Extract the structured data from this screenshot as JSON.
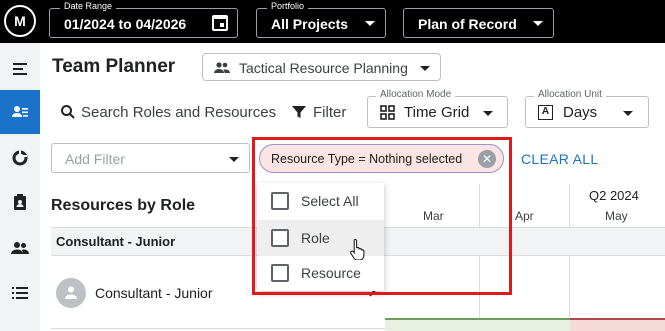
{
  "topbar": {
    "logo_text": "M",
    "date_range": {
      "label": "Date Range",
      "value": "01/2024 to 04/2026"
    },
    "portfolio": {
      "label": "Portfolio",
      "value": "All Projects"
    },
    "plan": {
      "value": "Plan of Record"
    }
  },
  "sidebar": {
    "items": [
      {
        "icon": "menu-icon"
      },
      {
        "icon": "team-planner-icon",
        "active": true
      },
      {
        "icon": "pie-chart-icon"
      },
      {
        "icon": "clipboard-person-icon"
      },
      {
        "icon": "people-icon"
      },
      {
        "icon": "list-icon"
      }
    ]
  },
  "header": {
    "title": "Team Planner",
    "view_select": "Tactical Resource Planning"
  },
  "toolbar": {
    "search_label": "Search Roles and Resources",
    "filter_label": "Filter",
    "allocation_mode": {
      "label": "Allocation Mode",
      "value": "Time Grid"
    },
    "allocation_unit": {
      "label": "Allocation Unit",
      "value": "Days"
    }
  },
  "filters": {
    "add_filter_placeholder": "Add Filter",
    "chip_text": "Resource Type = Nothing selected",
    "clear_all": "CLEAR ALL"
  },
  "dropdown": {
    "options": [
      "Select All",
      "Role",
      "Resource"
    ],
    "hovered": "Role"
  },
  "grid": {
    "quarter_label": "Q2 2024",
    "months": [
      "Mar",
      "Apr",
      "May"
    ]
  },
  "table": {
    "section_title": "Resources by Role",
    "group": "Consultant - Junior",
    "rows": [
      {
        "name": "Consultant - Junior"
      }
    ]
  },
  "colors": {
    "accent": "#1a73c8",
    "highlight_border": "#e0191e",
    "chip_border": "#9e8fd0"
  }
}
